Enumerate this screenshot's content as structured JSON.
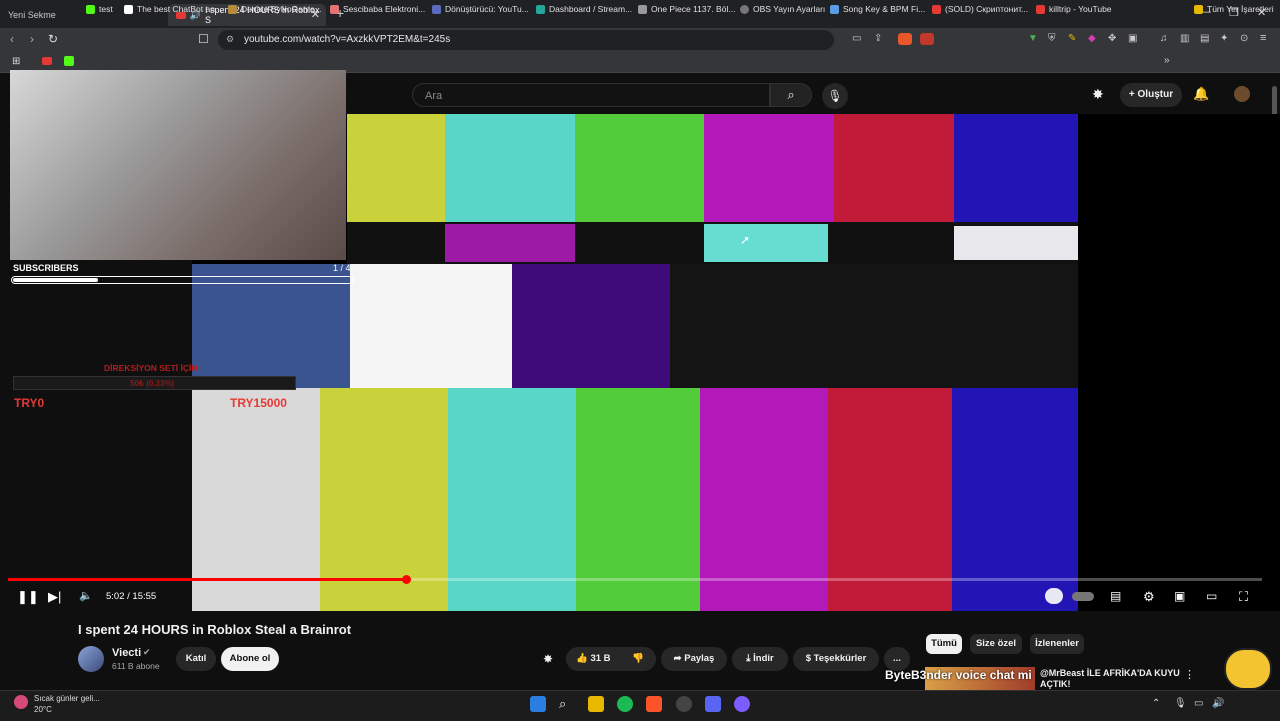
{
  "browser": {
    "tabs": [
      {
        "label": "Yeni Sekme"
      },
      {
        "label": "I spent 24 HOURS in Roblox S"
      }
    ],
    "url": "youtube.com/watch?v=AxzkkVPT2EM&t=245s",
    "bookmarks": [
      "test",
      "The best ChatBot an...",
      "Donate ByNoGame...",
      "Sescibaba Elektroni...",
      "Dönüştürücü: YouTu...",
      "Dashboard / Stream...",
      "One Piece 1137. Böl...",
      "OBS Yayın Ayarları",
      "Song Key & BPM Fi...",
      "(SOLD) Скриптонит...",
      "killtrip - YouTube"
    ],
    "all_bookmarks": "Tüm Yer İşaretleri"
  },
  "header": {
    "search_placeholder": "Ara",
    "create_label": "Oluştur"
  },
  "overlay": {
    "subs_label": "SUBSCRIBERS",
    "subs_count": "1 / 4",
    "subs_progress": 0.25,
    "goal_title": "DİREKSİYON SETİ İÇİN",
    "goal_value": "50₺ (0.33%)",
    "goal_min": "TRY0",
    "goal_max": "TRY15000"
  },
  "player": {
    "time": "5:02 / 15:55",
    "progress": 0.317
  },
  "video": {
    "title": "I spent 24 HOURS in Roblox Steal a Brainrot",
    "channel": "Viecti",
    "subscribers": "611 B abone",
    "join_label": "Katıl",
    "subscribe_label": "Abone ol",
    "likes": "31 B",
    "share_label": "Paylaş",
    "download_label": "İndir",
    "thanks_label": "Teşekkürler",
    "more_label": "..."
  },
  "chips": [
    "Tümü",
    "Size özel",
    "İzlenenler"
  ],
  "recommendation": {
    "title": "@MrBeast İLE AFRİKA'DA KUYU AÇTIK!",
    "overlay_text": "ByteB3nder voice chat mi"
  },
  "taskbar": {
    "weather_text": "Sıcak günler geli...",
    "temperature": "20°C"
  },
  "colors": {
    "accent": "#ff0000",
    "bg": "#0f0f0f"
  }
}
